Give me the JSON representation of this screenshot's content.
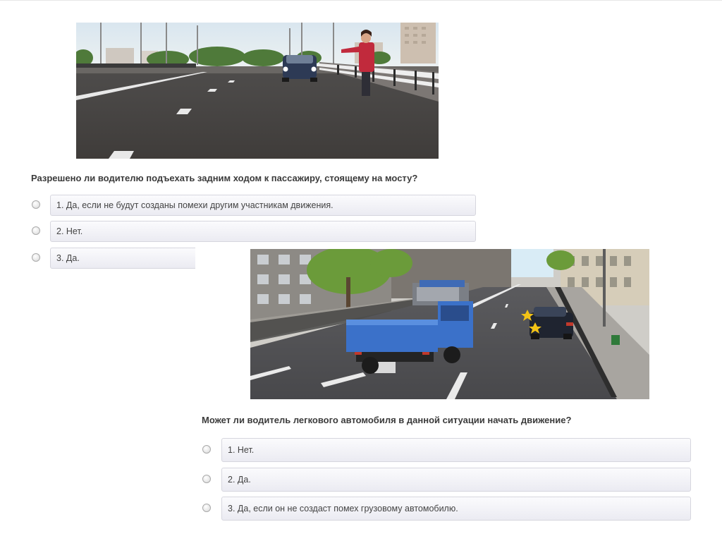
{
  "quiz1": {
    "question": "Разрешено ли водителю подъехать задним ходом к пассажиру, стоящему на мосту?",
    "answers": [
      "1. Да, если не будут созданы помехи другим участникам движения.",
      "2. Нет.",
      "3. Да."
    ]
  },
  "quiz2": {
    "question": "Может ли водитель легкового автомобиля в данной ситуации начать движение?",
    "answers": [
      "1. Нет.",
      "2. Да.",
      "3. Да, если он не создаст помех грузовому автомобилю."
    ]
  }
}
